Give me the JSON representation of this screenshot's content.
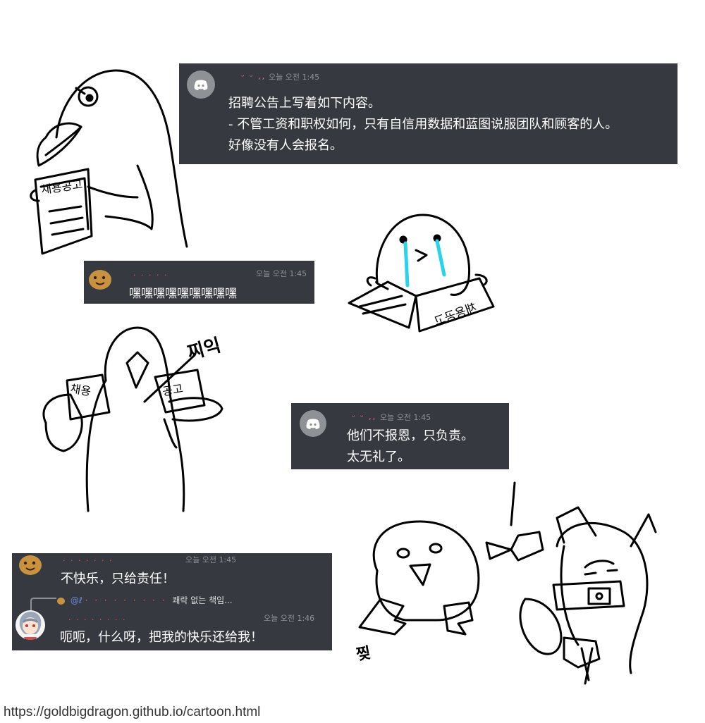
{
  "messages": [
    {
      "id": "m1",
      "avatar": "discord-logo-icon",
      "username": "ᵕ ᵕ ,,",
      "timestamp": "오늘 오전 1:45",
      "lines": [
        "招聘公告上写着如下内容。",
        "- 不管工资和职权如何，只有自信用数据和蓝图说服团队和顾客的人。",
        "好像没有人会报名。"
      ]
    },
    {
      "id": "m2",
      "avatar": "cookie-avatar",
      "username": "· · · · ·",
      "timestamp": "오늘 오전 1:45",
      "lines": [
        "嘿嘿嘿嘿嘿嘿嘿嘿嘿"
      ]
    },
    {
      "id": "m3",
      "avatar": "discord-logo-icon",
      "username": "ᵕ ᵕ ,,",
      "timestamp": "오늘 오전 1:45",
      "lines": [
        "他们不报恩，只负责。",
        "太无礼了。"
      ]
    },
    {
      "id": "m4",
      "avatar": "cookie-avatar",
      "username": "· · · · · · ·",
      "timestamp": "오늘 오전 1:45",
      "lines": [
        "不快乐，只给责任！"
      ]
    },
    {
      "id": "m5",
      "avatar": "anime-girl-avatar",
      "username": "· · · · · · · ·",
      "timestamp": "오늘 오전 1:46",
      "reply_prefix": "@ℓ",
      "reply_text": "쾌락 없는 책임...",
      "lines": [
        "呃呃，什么呀，把我的快乐还给我！"
      ]
    }
  ],
  "handwritten": [
    "채용공고",
    "찌익",
    "채용",
    "공고",
    "찢"
  ],
  "footer": {
    "url": "https://goldbigdragon.github.io/cartoon.html"
  },
  "colors": {
    "panel": "#36393f",
    "timestamp": "#8e9297",
    "tear": "#29d3e8",
    "username": "#f47b9b"
  }
}
